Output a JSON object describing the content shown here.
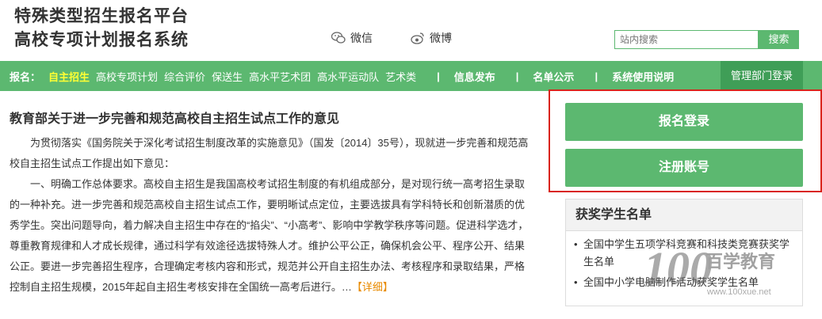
{
  "header": {
    "title_line1": "特殊类型招生报名平台",
    "title_line2": "高校专项计划报名系统",
    "wechat_label": "微信",
    "weibo_label": "微博",
    "search_placeholder": "站内搜索",
    "search_button": "搜索"
  },
  "nav": {
    "label": "报名：",
    "items": [
      "自主招生",
      "高校专项计划",
      "综合评价",
      "保送生",
      "高水平艺术团",
      "高水平运动队",
      "艺术类"
    ],
    "sep": "|",
    "info": "信息发布",
    "list": "名单公示",
    "help": "系统使用说明",
    "admin_login": "管理部门登录"
  },
  "article": {
    "title": "教育部关于进一步完善和规范高校自主招生试点工作的意见",
    "para1": "为贯彻落实《国务院关于深化考试招生制度改革的实施意见》（国发〔2014〕35号），现就进一步完善和规范高校自主招生试点工作提出如下意见：",
    "para2": "一、明确工作总体要求。高校自主招生是我国高校考试招生制度的有机组成部分，是对现行统一高考招生录取的一种补充。进一步完善和规范高校自主招生试点工作，要明晰试点定位，主要选拔具有学科特长和创新潜质的优秀学生。突出问题导向，着力解决自主招生中存在的“掐尖”、“小高考”、影响中学教学秩序等问题。促进科学选才，尊重教育规律和人才成长规律，通过科学有效途径选拔特殊人才。维护公平公正，确保机会公平、程序公开、结果公正。要进一步完善招生程序，合理确定考核内容和形式，规范并公开自主招生办法、考核程序和录取结果，严格控制自主招生规模，2015年起自主招生考核安排在全国统一高考后进行。",
    "ellipsis": "…",
    "more": "【详细】"
  },
  "side": {
    "login_button": "报名登录",
    "register_button": "注册账号",
    "award_title": "获奖学生名单",
    "award_items": [
      "全国中学生五项学科竞赛和科技类竞赛获奖学生名单",
      "全国中小学电脑制作活动获奖学生名单"
    ]
  },
  "watermark": {
    "big": "100",
    "cn": "百学教育",
    "url": "www.100xue.net"
  },
  "colors": {
    "brand_green": "#5cb870",
    "dark_green": "#3f9e57",
    "highlight_red": "#d9241c",
    "active_yellow": "#ffff33",
    "link_orange": "#e88a00"
  }
}
